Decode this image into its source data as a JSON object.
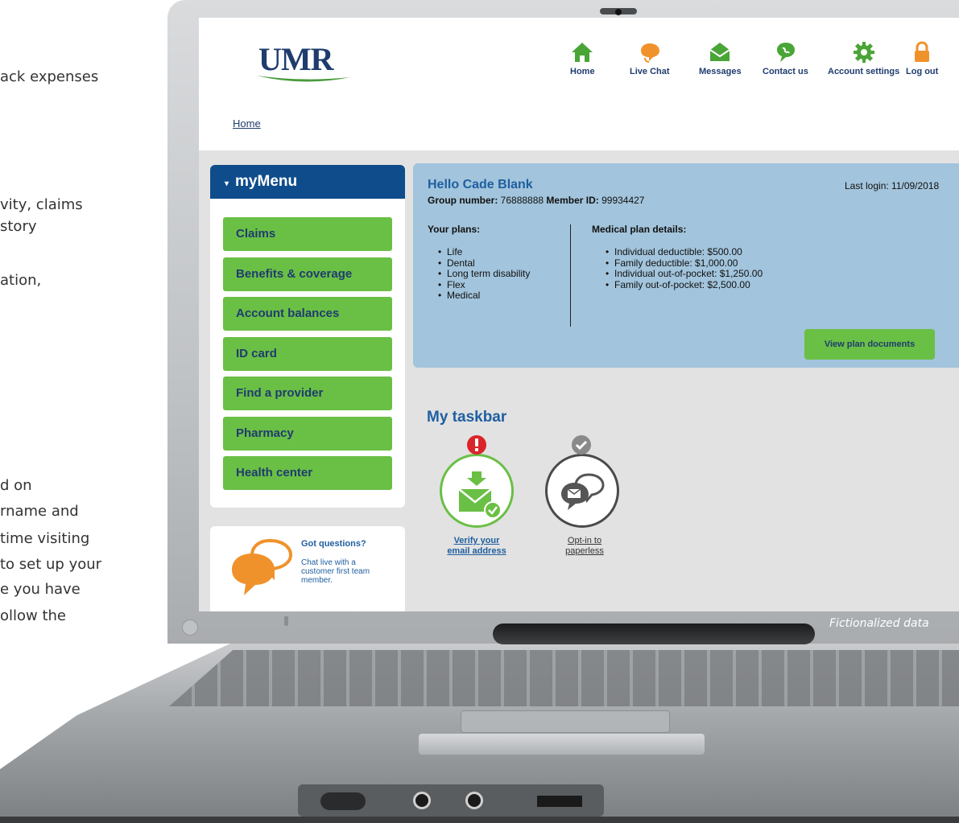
{
  "side_text": {
    "l1": "ack expenses",
    "l2": "vity, claims",
    "l3": "story",
    "l4": "ation,",
    "l5": "d on",
    "l6": "rname and",
    "l7": "time visiting",
    "l8": "to set up your",
    "l9": "e you have",
    "l10": "ollow the"
  },
  "watermark": "Fictionalized data",
  "header": {
    "logo": "UMR",
    "breadcrumb": "Home",
    "nav": [
      {
        "label": "Home",
        "icon": "home-icon"
      },
      {
        "label": "Live Chat",
        "icon": "chat-bubble-icon"
      },
      {
        "label": "Messages",
        "icon": "envelope-icon"
      },
      {
        "label": "Contact us",
        "icon": "contact-bubble-icon"
      },
      {
        "label": "Account settings",
        "icon": "gear-icon"
      },
      {
        "label": "Log out",
        "icon": "padlock-icon"
      }
    ]
  },
  "menu": {
    "title": "myMenu",
    "items": [
      "Claims",
      "Benefits & coverage",
      "Account balances",
      "ID card",
      "Find a provider",
      "Pharmacy",
      "Health center"
    ]
  },
  "chat_panel": {
    "title": "Got questions?",
    "description": "Chat live with a customer first team member."
  },
  "member": {
    "greeting": "Hello Cade Blank",
    "group_label": "Group number:",
    "group_number": "76888888",
    "member_label": "Member ID:",
    "member_id": "99934427",
    "last_login": "Last login: 11/09/2018"
  },
  "plans": {
    "heading": "Your plans:",
    "items": [
      "Life",
      "Dental",
      "Long term disability",
      "Flex",
      "Medical"
    ]
  },
  "medical_details": {
    "heading": "Medical plan details:",
    "items": [
      "Individual deductible: $500.00",
      "Family deductible: $1,000.00",
      "Individual out-of-pocket: $1,250.00",
      "Family out-of-pocket: $2,500.00"
    ]
  },
  "view_docs_button": "View plan documents",
  "taskbar": {
    "title": "My taskbar",
    "tasks": [
      {
        "label_1": "Verify your",
        "label_2": "email address",
        "status": "alert"
      },
      {
        "label_1": "Opt-in to",
        "label_2": "paperless",
        "status": "done"
      }
    ]
  },
  "colors": {
    "brand_green": "#6abf45",
    "brand_blue": "#0f4c8c",
    "info_panel": "#a2c4dc",
    "alert_red": "#d9252a",
    "chat_orange": "#f0922b"
  }
}
